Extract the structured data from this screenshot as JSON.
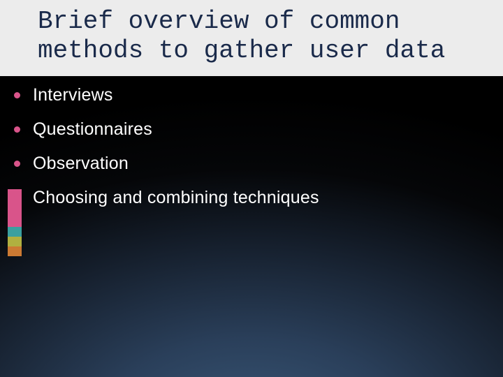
{
  "title": "Brief overview of common methods to gather user data",
  "bullets": [
    {
      "text": "Interviews"
    },
    {
      "text": "Questionnaires"
    },
    {
      "text": "Observation"
    },
    {
      "text": "Choosing and combining techniques"
    }
  ]
}
